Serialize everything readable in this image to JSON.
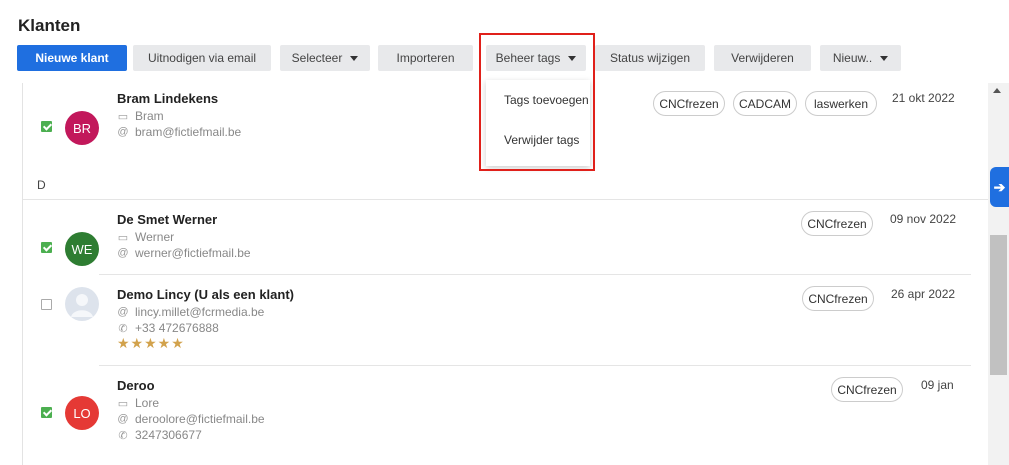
{
  "page": {
    "title": "Klanten"
  },
  "toolbar": {
    "new_client": "Nieuwe klant",
    "invite_email": "Uitnodigen via email",
    "select": "Selecteer",
    "import": "Importeren",
    "manage_tags": "Beheer tags",
    "change_status": "Status wijzigen",
    "delete": "Verwijderen",
    "new_more": "Nieuw.."
  },
  "tags_menu": {
    "add": "Tags toevoegen",
    "remove": "Verwijder tags"
  },
  "section_letter": "D",
  "clients": [
    {
      "name": "Bram Lindekens",
      "initials": "BR",
      "avatar_color": "#c2185b",
      "checked": true,
      "firstname": "Bram",
      "email": "bram@fictiefmail.be",
      "date": "21 okt 2022",
      "tags": [
        "CNCfrezen",
        "CADCAM",
        "laswerken"
      ]
    },
    {
      "name": "De Smet Werner",
      "initials": "WE",
      "avatar_color": "#2e7d32",
      "checked": true,
      "firstname": "Werner",
      "email": "werner@fictiefmail.be",
      "date": "09 nov 2022",
      "tags": [
        "CNCfrezen"
      ]
    },
    {
      "name": "Demo Lincy (U als een klant)",
      "initials": "",
      "avatar_color": "#dde3ec",
      "checked": false,
      "email": "lincy.millet@fcrmedia.be",
      "phone": "+33 472676888",
      "stars": "★★★★★",
      "date": "26 apr 2022",
      "tags": [
        "CNCfrezen"
      ]
    },
    {
      "name": "Deroo",
      "initials": "LO",
      "avatar_color": "#e53935",
      "checked": true,
      "firstname": "Lore",
      "email": "deroolore@fictiefmail.be",
      "phone": "3247306677",
      "date": "09 jan",
      "tags": [
        "CNCfrezen"
      ]
    }
  ],
  "icons": {
    "card": "id-card-icon",
    "at": "at-icon",
    "phone": "phone-icon",
    "side": "arrow-right-icon"
  },
  "colors": {
    "primary": "#1f6fe0",
    "highlight": "#e0201a",
    "star": "#d2a24c",
    "check": "#4caf50"
  }
}
